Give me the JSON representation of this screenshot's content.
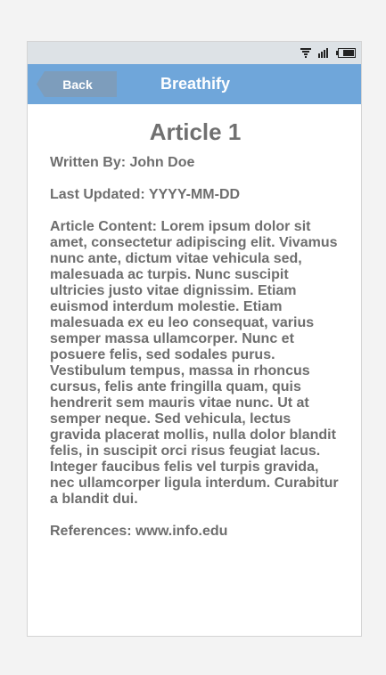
{
  "status_bar": {
    "icons": [
      "wifi-icon",
      "signal-icon",
      "battery-icon"
    ]
  },
  "nav": {
    "back_label": "Back",
    "title": "Breathify"
  },
  "article": {
    "title": "Article 1",
    "author": "Written By: John Doe",
    "updated": "Last Updated: YYYY-MM-DD",
    "content": "Article Content: Lorem ipsum dolor sit amet, consectetur adipiscing elit. Vivamus nunc ante, dictum vitae vehicula sed, malesuada ac turpis. Nunc suscipit ultricies justo vitae dignissim. Etiam euismod interdum molestie. Etiam malesuada ex eu leo consequat, varius semper massa ullamcorper. Nunc et posuere felis, sed sodales purus. Vestibulum tempus, massa in rhoncus cursus, felis ante fringilla quam, quis hendrerit sem mauris vitae nunc. Ut at semper neque. Sed vehicula, lectus gravida placerat mollis, nulla dolor blandit felis, in suscipit orci risus feugiat lacus. Integer faucibus felis vel turpis gravida, nec ullamcorper ligula interdum. Curabitur a blandit dui.",
    "references": "References: www.info.edu"
  },
  "colors": {
    "nav_bar": "#6fa6da",
    "back_button": "#7d9dbc",
    "status_bar": "#dde2e6",
    "text": "#6e6e6e"
  }
}
